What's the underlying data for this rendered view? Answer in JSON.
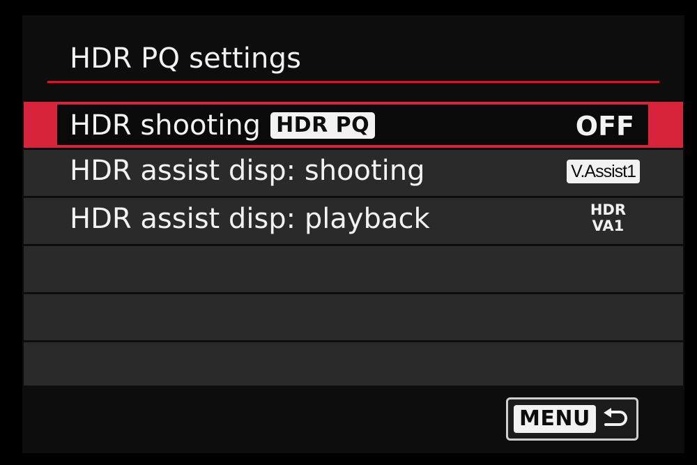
{
  "screen": {
    "title": "HDR PQ settings"
  },
  "menu": {
    "items": [
      {
        "label": "HDR shooting",
        "badge": "HDR PQ",
        "value": "OFF",
        "selected": true
      },
      {
        "label": "HDR assist disp: shooting",
        "value": "V.Assist1",
        "selected": false
      },
      {
        "label": "HDR assist disp: playback",
        "value_line1": "HDR",
        "value_line2": "VA1",
        "selected": false
      }
    ]
  },
  "footer": {
    "menu_label": "MENU",
    "return_icon": "return-arrow-icon"
  },
  "colors": {
    "accent": "#d8243a",
    "row_background": "#2a2a2a",
    "text": "#f2f2f2"
  }
}
